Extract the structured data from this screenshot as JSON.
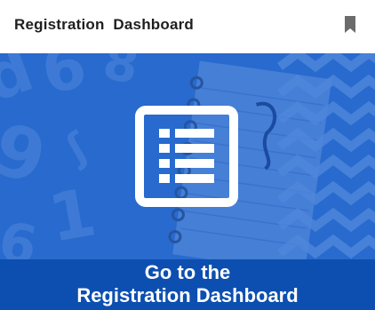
{
  "header": {
    "title": "Registration  Dashboard",
    "bookmark_icon": "bookmark-icon"
  },
  "hero": {
    "image_icon": "list-document-icon",
    "caption_line1": "Go to the",
    "caption_line2": "Registration Dashboard"
  },
  "colors": {
    "hero_blue": "#2f6fd1",
    "caption_blue": "#0c4fb0",
    "title_text": "#1f1f1f",
    "icon_gray": "#6b6b6b"
  }
}
